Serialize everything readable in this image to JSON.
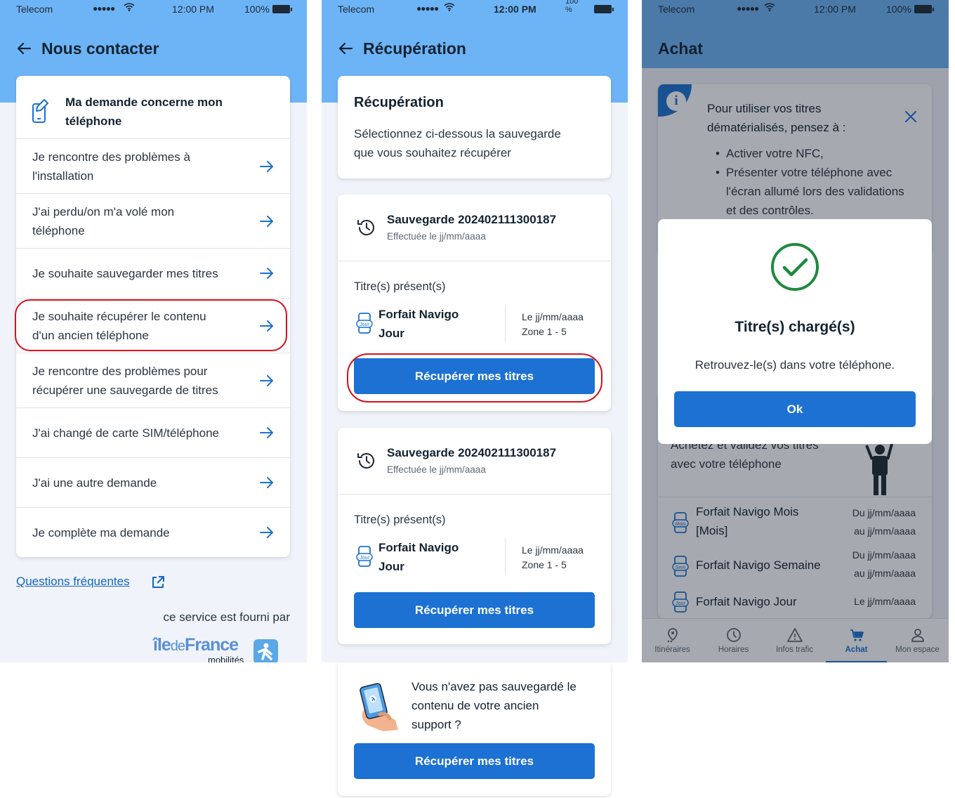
{
  "status": {
    "carrier": "Telecom",
    "dots": "●●●●●",
    "time": "12:00 PM",
    "battery": "100%",
    "battery_alt": "100 %"
  },
  "screen1": {
    "title": "Nous contacter",
    "header_line1": "Ma demande concerne mon",
    "header_line2": "téléphone",
    "items": [
      {
        "l1": "Je rencontre des problèmes à",
        "l2": "l'installation"
      },
      {
        "l1": "J'ai perdu/on m'a volé mon",
        "l2": "téléphone"
      },
      {
        "l1": "Je souhaite sauvegarder mes titres",
        "l2": ""
      },
      {
        "l1": "Je souhaite récupérer le contenu",
        "l2": "d'un ancien téléphone"
      },
      {
        "l1": "Je rencontre des problèmes pour",
        "l2": "récupérer une sauvegarde de titres"
      },
      {
        "l1": "J'ai changé de carte SIM/téléphone",
        "l2": ""
      },
      {
        "l1": "J'ai une autre demande",
        "l2": ""
      },
      {
        "l1": "Je complète ma demande",
        "l2": ""
      }
    ],
    "faq_link": "Questions fréquentes",
    "provided_by": "ce service est fourni par",
    "logo_ile": "île",
    "logo_de": "de",
    "logo_france": "France",
    "logo_mobilites": "mobilités"
  },
  "screen2": {
    "title": "Récupération",
    "intro_title": "Récupération",
    "intro_l1": "Sélectionnez ci-dessous la sauvegarde",
    "intro_l2": "que vous souhaitez récupérer",
    "backups": [
      {
        "name": "Sauvegarde 202402111300187",
        "date": "Effectuée le jj/mm/aaaa",
        "titles_label": "Titre(s) présent(s)",
        "ticket_l1": "Forfait Navigo",
        "ticket_l2": "Jour",
        "ticket_badge": "Jour",
        "valid_prefix": "Le ",
        "valid_date": "jj/mm/aaaa",
        "zone": "Zone 1 - 5",
        "button": "Récupérer mes titres"
      },
      {
        "name": "Sauvegarde 202402111300187",
        "date": "Effectuée le jj/mm/aaaa",
        "titles_label": "Titre(s) présent(s)",
        "ticket_l1": "Forfait Navigo",
        "ticket_l2": "Jour",
        "ticket_badge": "Jour",
        "valid_prefix": "Le ",
        "valid_date": "jj/mm/aaaa",
        "zone": "Zone 1 - 5",
        "button": "Récupérer mes titres"
      }
    ],
    "nosave_l1": "Vous n'avez pas sauvegardé le",
    "nosave_l2": "contenu de votre ancien",
    "nosave_l3": "support ?",
    "nosave_button": "Récupérer mes titres"
  },
  "screen3": {
    "title": "Achat",
    "info_l1": "Pour utiliser vos titres",
    "info_l2": "dématérialisés, pensez à :",
    "bullet1": "Activer votre NFC,",
    "bullet2_l1": "Présenter votre téléphone avec",
    "bullet2_l2": "l'écran allumé lors des validations",
    "bullet2_l3": "et des contrôles.",
    "behind_l1": "Achetez et validez vos titres",
    "behind_l2": "avec votre téléphone",
    "products": [
      {
        "l1": "Forfait Navigo Mois",
        "l2": "[Mois]",
        "badge": "Mois",
        "d1": "Du jj/mm/aaaa",
        "d2": "au jj/mm/aaaa"
      },
      {
        "l1": "Forfait Navigo Semaine",
        "l2": "",
        "badge": "Sem",
        "d1": "Du jj/mm/aaaa",
        "d2": "au jj/mm/aaaa"
      },
      {
        "l1": "Forfait Navigo Jour",
        "l2": "",
        "badge": "Jour",
        "d1": "Le jj/mm/aaaa",
        "d2": ""
      }
    ],
    "tabs": [
      "Itinéraires",
      "Horaires",
      "Infos trafic",
      "Achat",
      "Mon espace"
    ],
    "modal_title": "Titre(s) chargé(s)",
    "modal_text": "Retrouvez-le(s) dans votre téléphone.",
    "modal_button": "Ok"
  },
  "colors": {
    "primary": "#1c71d2",
    "header": "#6db4f6",
    "success": "#1e8a3e",
    "highlight": "#d4101d"
  }
}
